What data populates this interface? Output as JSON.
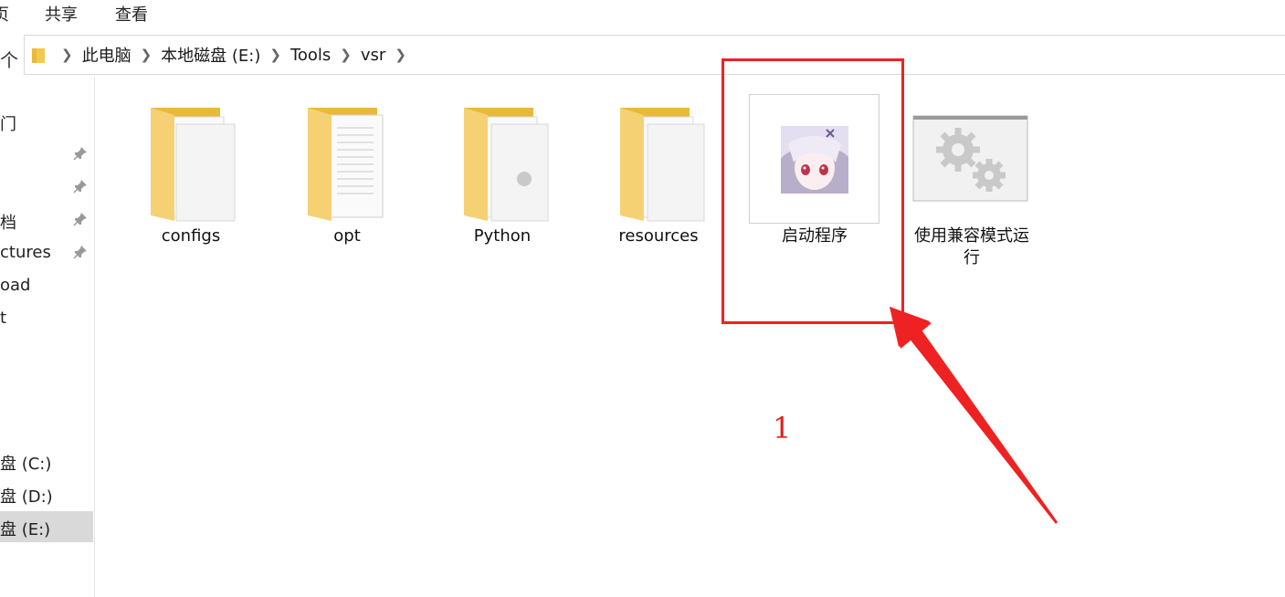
{
  "ribbon": {
    "tabs": [
      "页",
      "共享",
      "查看"
    ]
  },
  "address": {
    "up_label": "个",
    "crumbs": [
      "此电脑",
      "本地磁盘 (E:)",
      "Tools",
      "vsr"
    ]
  },
  "nav": {
    "items": [
      "门",
      "",
      "",
      "档",
      "ctures",
      "oad",
      "t",
      "盘 (C:)",
      "盘 (D:)",
      "盘 (E:)"
    ]
  },
  "content": {
    "items": [
      "configs",
      "opt",
      "Python",
      "resources",
      "启动程序",
      "使用兼容模式运行"
    ]
  },
  "annotation": {
    "number": "1",
    "color": "#ee2222"
  }
}
